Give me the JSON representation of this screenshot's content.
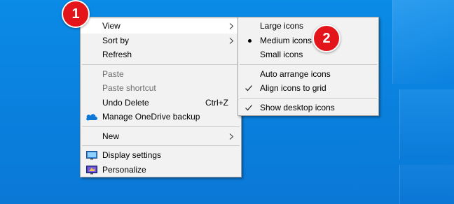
{
  "context_menu": {
    "items": [
      {
        "label": "View",
        "has_submenu": true,
        "hover": true
      },
      {
        "label": "Sort by",
        "has_submenu": true
      },
      {
        "label": "Refresh"
      },
      {
        "separator": true
      },
      {
        "label": "Paste",
        "disabled": true
      },
      {
        "label": "Paste shortcut",
        "disabled": true
      },
      {
        "label": "Undo Delete",
        "shortcut": "Ctrl+Z"
      },
      {
        "label": "Manage OneDrive backup",
        "icon": "onedrive-icon"
      },
      {
        "separator": true
      },
      {
        "label": "New",
        "has_submenu": true
      },
      {
        "separator": true
      },
      {
        "label": "Display settings",
        "icon": "display-settings-icon"
      },
      {
        "label": "Personalize",
        "icon": "personalize-icon"
      }
    ]
  },
  "view_submenu": {
    "items": [
      {
        "label": "Large icons"
      },
      {
        "label": "Medium icons",
        "selected": true
      },
      {
        "label": "Small icons"
      },
      {
        "separator": true
      },
      {
        "label": "Auto arrange icons"
      },
      {
        "label": "Align icons to grid",
        "checked": true
      },
      {
        "separator": true
      },
      {
        "label": "Show desktop icons",
        "checked": true
      }
    ]
  },
  "badges": {
    "step1": "1",
    "step2": "2"
  },
  "colors": {
    "desktop": "#0a85e2",
    "menu_bg": "#f2f2f2",
    "badge": "#e3151b",
    "onedrive": "#0f78d4"
  }
}
